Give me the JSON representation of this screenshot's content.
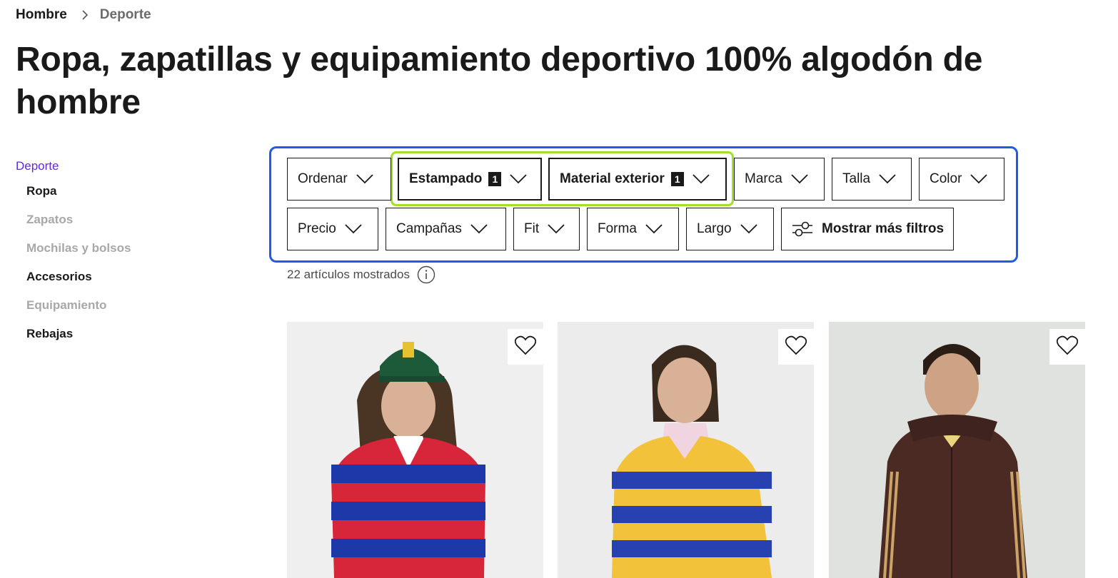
{
  "breadcrumb": {
    "home": "Hombre",
    "current": "Deporte"
  },
  "page_title": "Ropa, zapatillas y equipamiento deportivo 100% algodón de hombre",
  "sidebar": {
    "category": "Deporte",
    "items": [
      {
        "label": "Ropa",
        "state": "active"
      },
      {
        "label": "Zapatos",
        "state": "muted"
      },
      {
        "label": "Mochilas y bolsos",
        "state": "muted"
      },
      {
        "label": "Accesorios",
        "state": "active"
      },
      {
        "label": "Equipamiento",
        "state": "muted"
      },
      {
        "label": "Rebajas",
        "state": "active"
      }
    ]
  },
  "filters": {
    "ordenar": "Ordenar",
    "estampado": "Estampado",
    "estampado_count": "1",
    "material": "Material exterior",
    "material_count": "1",
    "marca": "Marca",
    "talla": "Talla",
    "color": "Color",
    "precio": "Precio",
    "campanas": "Campañas",
    "fit": "Fit",
    "forma": "Forma",
    "largo": "Largo",
    "more": "Mostrar más filtros"
  },
  "results": {
    "count_text": "22 artículos mostrados"
  },
  "colors": {
    "accent_purple": "#6328e0",
    "frame_blue": "#1e5be6",
    "frame_green": "#9fe02a"
  },
  "products": [
    {
      "icon": "heart-icon"
    },
    {
      "icon": "heart-icon"
    },
    {
      "icon": "heart-icon"
    }
  ]
}
